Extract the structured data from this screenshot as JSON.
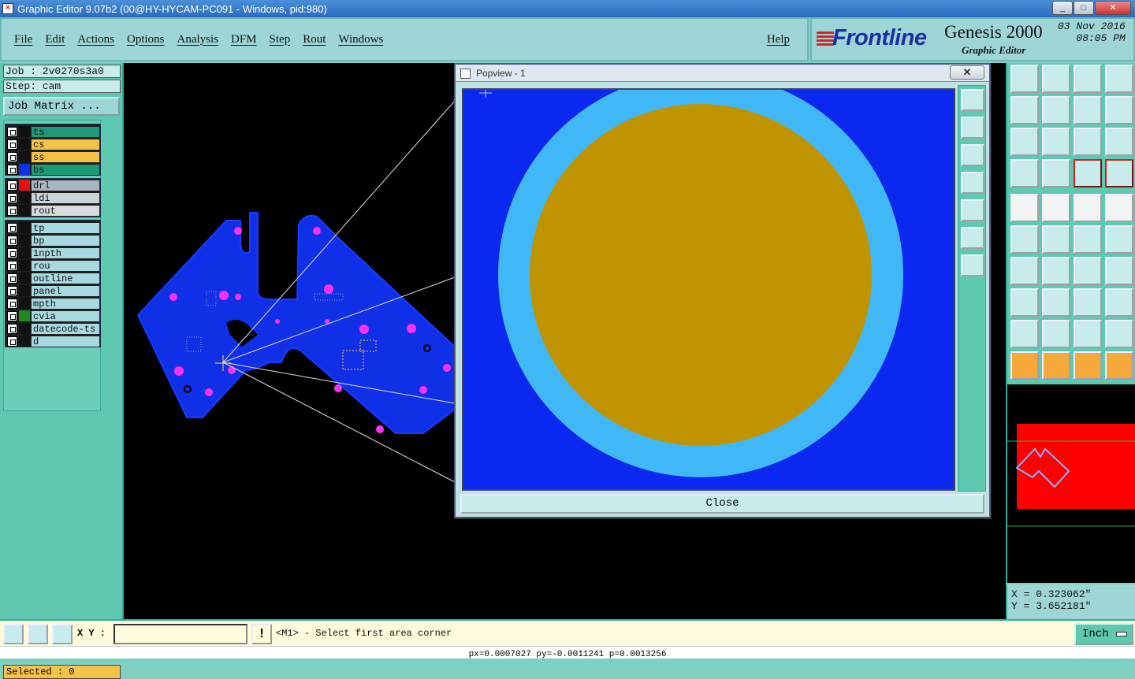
{
  "window": {
    "title": "Graphic Editor 9.07b2 (00@HY-HYCAM-PC091 - Windows, pid:980)",
    "min": "_",
    "max": "□",
    "close": "✕"
  },
  "menu": {
    "items": [
      "File",
      "Edit",
      "Actions",
      "Options",
      "Analysis",
      "DFM",
      "Step",
      "Rout",
      "Windows"
    ],
    "help": "Help"
  },
  "brand": {
    "logo": "Frontline",
    "product": "Genesis 2000",
    "subtitle": "Graphic Editor",
    "date": "03 Nov 2016",
    "time": "08:05 PM"
  },
  "job": {
    "job_label": "Job : 2v0270s3a0",
    "step_label": "Step: cam",
    "matrix_button": "Job Matrix ..."
  },
  "layers": [
    {
      "name": "ts",
      "color": "#1e9a76",
      "sw": "#111"
    },
    {
      "name": "cs",
      "color": "#f6c34a",
      "sw": "#111"
    },
    {
      "name": "ss",
      "color": "#f6c34a",
      "sw": "#111"
    },
    {
      "name": "bs",
      "color": "#1e9a76",
      "sw": "#1030e8"
    },
    {
      "name": "drl",
      "color": "#a9b6c0",
      "sw": "#e81010"
    },
    {
      "name": "ldi",
      "color": "#c8d4d8",
      "sw": "#111"
    },
    {
      "name": "rout",
      "color": "#d8dcdc",
      "sw": "#111"
    },
    {
      "name": "tp",
      "color": "#a8d8e0",
      "sw": "#111"
    },
    {
      "name": "bp",
      "color": "#a8d8e0",
      "sw": "#111"
    },
    {
      "name": "1npth",
      "color": "#a8d8e0",
      "sw": "#111"
    },
    {
      "name": "rou",
      "color": "#a8d8e0",
      "sw": "#111"
    },
    {
      "name": "outline",
      "color": "#a8d8e0",
      "sw": "#111"
    },
    {
      "name": "panel",
      "color": "#a8d8e0",
      "sw": "#111"
    },
    {
      "name": "mpth",
      "color": "#a8d8e0",
      "sw": "#111"
    },
    {
      "name": "cvia",
      "color": "#a8d8e0",
      "sw": "#1e8a1e"
    },
    {
      "name": "datecode-ts",
      "color": "#a8d8e0",
      "sw": "#111"
    },
    {
      "name": "d",
      "color": "#a8d8e0",
      "sw": "#111"
    }
  ],
  "selected": "Selected : 0",
  "popview": {
    "title": "Popview - 1",
    "close_x": "✕",
    "close_button": "Close"
  },
  "coords": {
    "x": "X = 0.323062\"",
    "y": "Y = 3.652181\""
  },
  "command": {
    "xy_label": "X Y :",
    "xy_value": "",
    "warn": "!",
    "prompt": "<M1> - Select first area corner",
    "unit": "Inch"
  },
  "status": "px=0.0007027 py=-0.0011241 p=0.0013256",
  "colors": {
    "accent": "#1030e8",
    "pad": "#c09400",
    "ring": "#40b8f8",
    "via": "#ff30ff",
    "overview": "#ff0000"
  }
}
